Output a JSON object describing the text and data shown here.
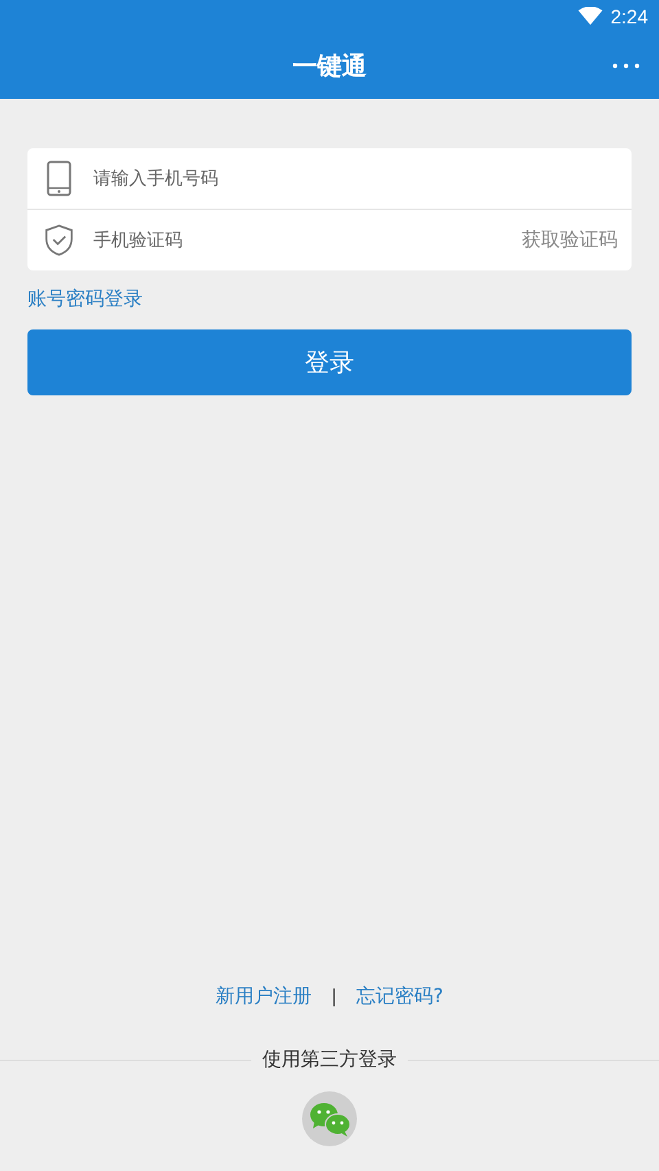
{
  "status_bar": {
    "time": "2:24"
  },
  "app_bar": {
    "title": "一键通"
  },
  "form": {
    "phone_field": {
      "placeholder": "请输入手机号码"
    },
    "code_field": {
      "placeholder": "手机验证码"
    },
    "get_code_button": "获取验证码"
  },
  "password_login_link": "账号密码登录",
  "login_button": "登录",
  "footer": {
    "register_link": "新用户注册",
    "separator": "|",
    "forgot_link": "忘记密码?",
    "third_party_label": "使用第三方登录"
  }
}
